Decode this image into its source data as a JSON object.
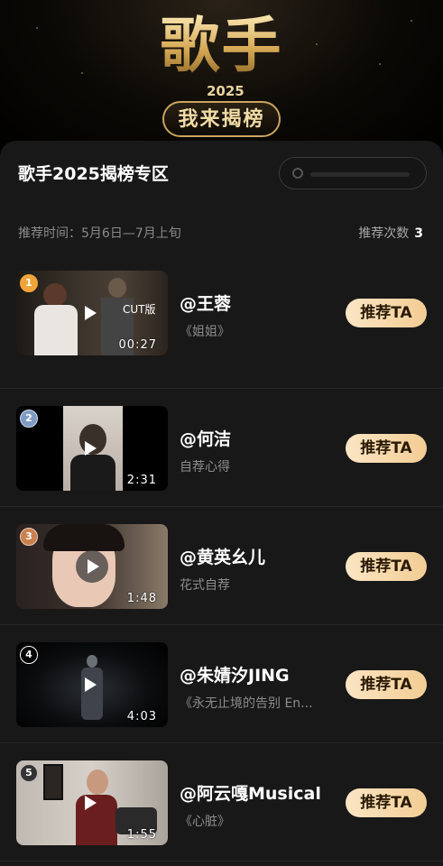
{
  "banner": {
    "logo_text": "歌手",
    "logo_year": "2025",
    "logo_sub": "我来揭榜"
  },
  "panel": {
    "title": "歌手2025揭榜专区",
    "search_placeholder": "",
    "time_label": "推荐时间：5月6日—7月上旬",
    "count_label": "推荐次数",
    "count_value": "3"
  },
  "items": [
    {
      "rank": "1",
      "rank_color": "#f0a43a",
      "name": "@王蓉",
      "desc": "《姐姐》",
      "duration": "00:27",
      "button": "推荐TA",
      "overlay": "CUT版"
    },
    {
      "rank": "2",
      "rank_color": "#7f9cc4",
      "name": "@何洁",
      "desc": "自荐心得",
      "duration": "2:31",
      "button": "推荐TA"
    },
    {
      "rank": "3",
      "rank_color": "#c9824f",
      "name": "@黄英幺儿",
      "desc": "花式自荐",
      "duration": "1:48",
      "button": "推荐TA"
    },
    {
      "rank": "4",
      "rank_color": "#000000",
      "name": "@朱婧汐JING",
      "desc": "《永无止境的告别 En...",
      "duration": "4:03",
      "button": "推荐TA"
    },
    {
      "rank": "5",
      "rank_color": "#333333",
      "name": "@阿云嘎Musical",
      "desc": "《心脏》",
      "duration": "1:55",
      "button": "推荐TA"
    }
  ],
  "colors": {
    "accent_button_start": "#fbe5c4",
    "accent_button_end": "#f2cd94",
    "gold": "#d7aa55",
    "panel_bg": "#181818"
  }
}
